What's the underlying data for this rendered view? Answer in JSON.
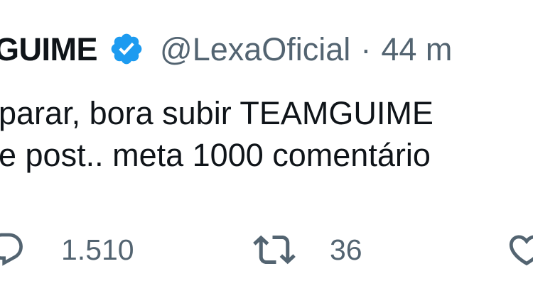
{
  "tweet": {
    "author": {
      "display_name": "GUIME",
      "verified": true,
      "handle": "@LexaOficial",
      "separator": "·",
      "time": "44 m"
    },
    "text_lines": [
      "parar, bora subir TEAMGUIME",
      "e post.. meta 1000 comentário"
    ],
    "actions": {
      "reply_count": "1.510",
      "retweet_count": "36"
    }
  },
  "icons": {
    "verified": "verified-badge-icon",
    "reply": "reply-bubble-icon",
    "retweet": "retweet-icon",
    "like": "heart-icon"
  },
  "colors": {
    "text_primary": "#0f1419",
    "text_secondary": "#536471",
    "verified_blue": "#1d9bf0",
    "background": "#ffffff"
  }
}
